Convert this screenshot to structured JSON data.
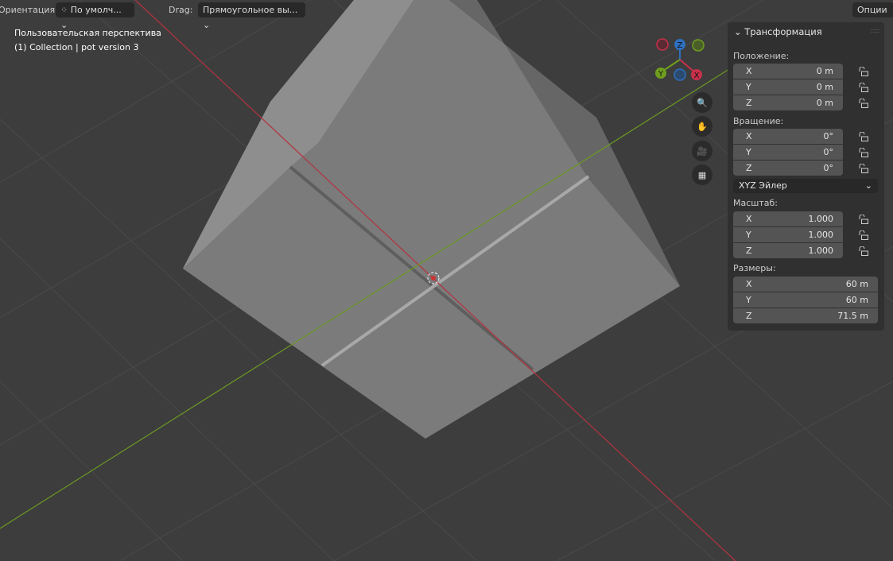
{
  "header": {
    "orientation_label": "Ориентация:",
    "orientation_value": "По умолч...",
    "drag_label": "Drag:",
    "drag_value": "Прямоугольное вы...",
    "options_label": "Опции"
  },
  "overlay": {
    "view_name": "Пользовательская перспектива",
    "collection": "(1) Collection | pot version 3"
  },
  "gizmo": {
    "x": "X",
    "y": "Y",
    "z": "Z",
    "colors": {
      "x": "#c8304a",
      "y": "#6f9e1e",
      "z": "#2e6fbf"
    }
  },
  "nav_icons": [
    "zoom-icon",
    "hand-pan-icon",
    "camera-icon",
    "grid-ortho-icon"
  ],
  "panel": {
    "title": "Трансформация",
    "location_label": "Положение:",
    "location": [
      {
        "axis": "X",
        "value": "0 m"
      },
      {
        "axis": "Y",
        "value": "0 m"
      },
      {
        "axis": "Z",
        "value": "0 m"
      }
    ],
    "rotation_label": "Вращение:",
    "rotation": [
      {
        "axis": "X",
        "value": "0°"
      },
      {
        "axis": "Y",
        "value": "0°"
      },
      {
        "axis": "Z",
        "value": "0°"
      }
    ],
    "rotation_mode": "XYZ Эйлер",
    "scale_label": "Масштаб:",
    "scale": [
      {
        "axis": "X",
        "value": "1.000"
      },
      {
        "axis": "Y",
        "value": "1.000"
      },
      {
        "axis": "Z",
        "value": "1.000"
      }
    ],
    "dimensions_label": "Размеры:",
    "dimensions": [
      {
        "axis": "X",
        "value": "60 m"
      },
      {
        "axis": "Y",
        "value": "60 m"
      },
      {
        "axis": "Z",
        "value": "71.5 m"
      }
    ]
  }
}
